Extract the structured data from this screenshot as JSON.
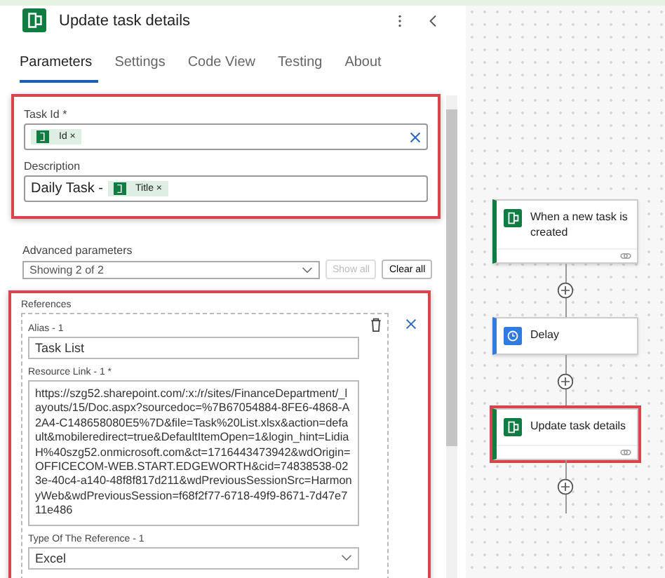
{
  "panel": {
    "title": "Update task details",
    "tabs": [
      {
        "label": "Parameters",
        "selected": true
      },
      {
        "label": "Settings",
        "selected": false
      },
      {
        "label": "Code View",
        "selected": false
      },
      {
        "label": "Testing",
        "selected": false
      },
      {
        "label": "About",
        "selected": false
      }
    ]
  },
  "fields": [
    {
      "label": "Task Id *",
      "token": "Id",
      "token_remove": "×",
      "clearable": true
    },
    {
      "label": "Description",
      "prefix": "Daily Task -",
      "token": "Title",
      "token_remove": "×",
      "clearable": false
    }
  ],
  "advanced": {
    "label": "Advanced parameters",
    "value": "Showing 2 of 2",
    "show_all": "Show all",
    "clear_all": "Clear all",
    "show_all_disabled": true
  },
  "references": {
    "label": "References",
    "alias_label": "Alias - 1",
    "alias": "Task List",
    "link_label": "Resource Link - 1 *",
    "link": "https://szg52.sharepoint.com/:x:/r/sites/FinanceDepartment/_layouts/15/Doc.aspx?sourcedoc=%7B67054884-8FE6-4868-A2A4-C148658080E5%7D&file=Task%20List.xlsx&action=default&mobileredirect=true&DefaultItemOpen=1&login_hint=LidiaH%40szg52.onmicrosoft.com&ct=1716443473942&wdOrigin=OFFICECOM-WEB.START.EDGEWORTH&cid=74838538-023e-40c4-a140-48f8f817d211&wdPreviousSessionSrc=HarmonyWeb&wdPreviousSession=f68f2f77-6718-49f9-8671-7d47e711e486",
    "type_label": "Type Of The Reference - 1",
    "type": "Excel"
  },
  "flow": [
    {
      "kind": "planner",
      "title": "When a new task is created",
      "selected": false
    },
    {
      "kind": "delay",
      "title": "Delay",
      "selected": false
    },
    {
      "kind": "planner",
      "title": "Update task details",
      "selected": true
    }
  ]
}
